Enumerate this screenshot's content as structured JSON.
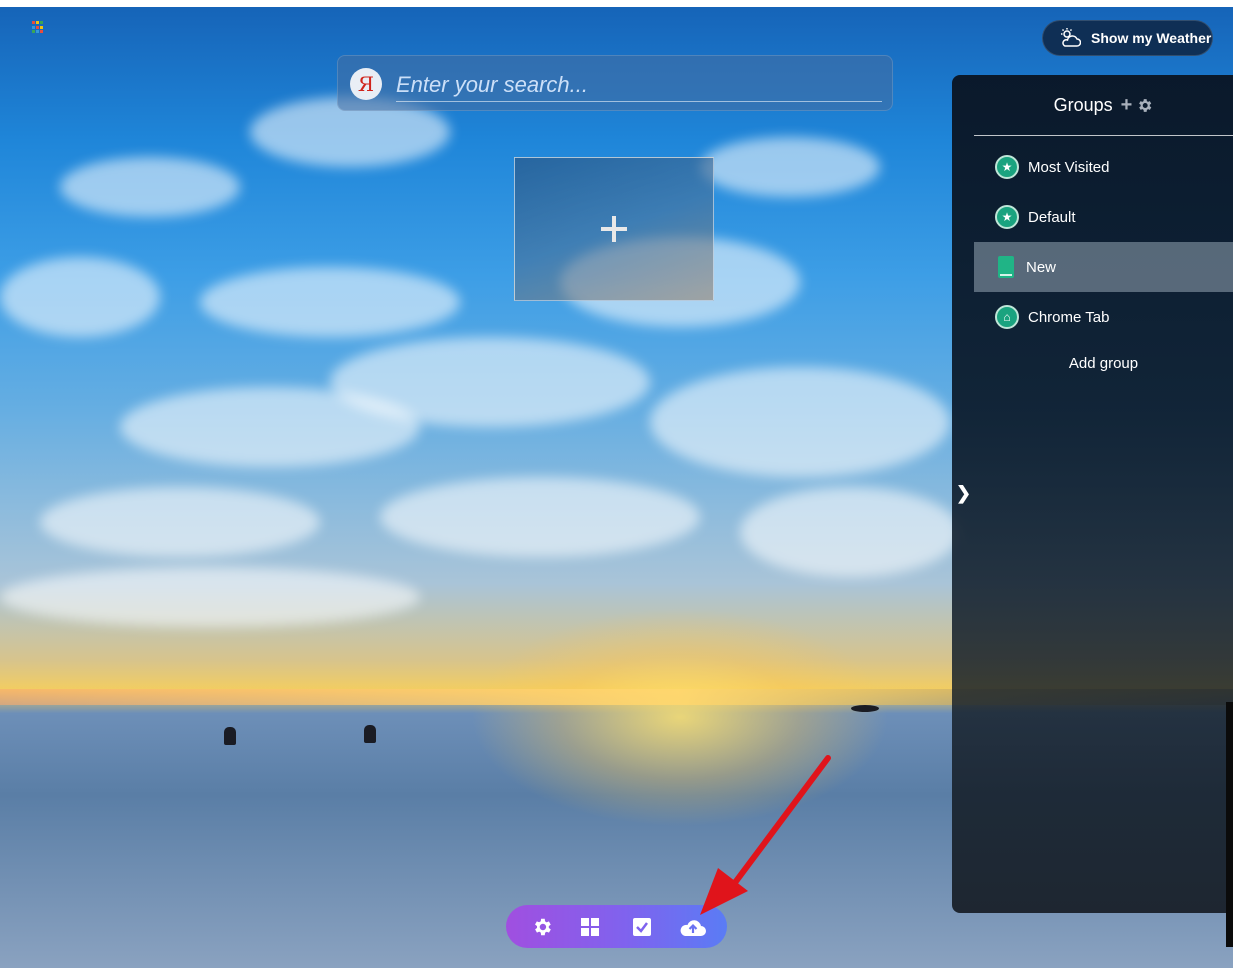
{
  "weather": {
    "label": "Show my Weather",
    "icon": "cloud-sun-icon"
  },
  "search": {
    "placeholder": "Enter your search...",
    "engine_logo": "Я"
  },
  "tiles": {
    "add_tile_icon": "plus-icon"
  },
  "groups": {
    "title": "Groups",
    "add_icon": "+",
    "items": [
      {
        "label": "Most Visited",
        "icon": "star-badge-icon"
      },
      {
        "label": "Default",
        "icon": "star-badge-icon"
      },
      {
        "label": "New",
        "icon": "book-icon",
        "active": true
      },
      {
        "label": "Chrome Tab",
        "icon": "home-badge-icon"
      }
    ],
    "add_group_label": "Add group",
    "collapse_glyph": "❯"
  },
  "dock": {
    "buttons": [
      {
        "name": "settings-icon"
      },
      {
        "name": "grid-icon"
      },
      {
        "name": "checkbox-icon"
      },
      {
        "name": "cloud-upload-icon"
      }
    ]
  },
  "colors": {
    "accent_green": "#1aa37f",
    "dock_start": "#a04fe0",
    "dock_end": "#5a7cf5",
    "annotation_arrow": "#e0141b"
  }
}
